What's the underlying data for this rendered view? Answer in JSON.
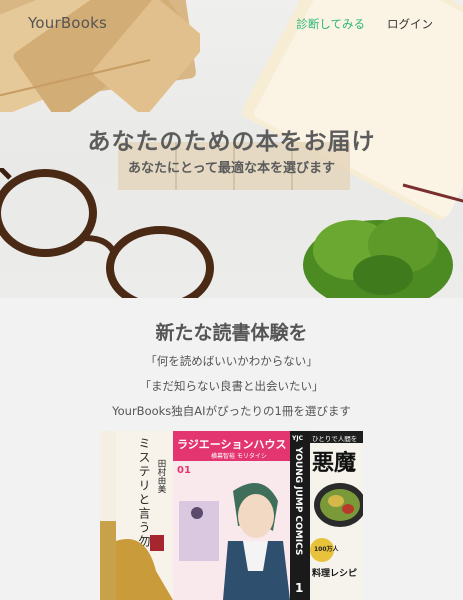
{
  "nav": {
    "logo": "YourBooks",
    "diagnose": "診断してみる",
    "login": "ログイン"
  },
  "hero": {
    "title": "あなたのための本をお届け",
    "subtitle": "あなたにとって最適な本を選びます"
  },
  "section": {
    "title": "新たな読書体験を",
    "lines": [
      "「何を読めばいいかわからない」",
      "「まだ知らない良書と出会いたい」",
      "YourBooks独自AIがぴったりの1冊を選びます"
    ]
  },
  "books": {
    "book2_title": "ミステリと言う勿れ",
    "book2_author": "田村由美",
    "book3_title": "ラジエーションハウス",
    "book3_vol": "01",
    "book3_author": "横幕智裕 モリタイシ",
    "book4_label": "YOUNG JUMP COMICS",
    "book4_badge": "YJC",
    "book4_vol": "1",
    "book5_top": "ひとりで人間を",
    "book5_title": "悪魔",
    "book5_num": "100万人",
    "book5_name": "料理レシピ"
  },
  "colors": {
    "accent": "#2bb673",
    "text": "#555555",
    "background": "#f2f2f2"
  }
}
